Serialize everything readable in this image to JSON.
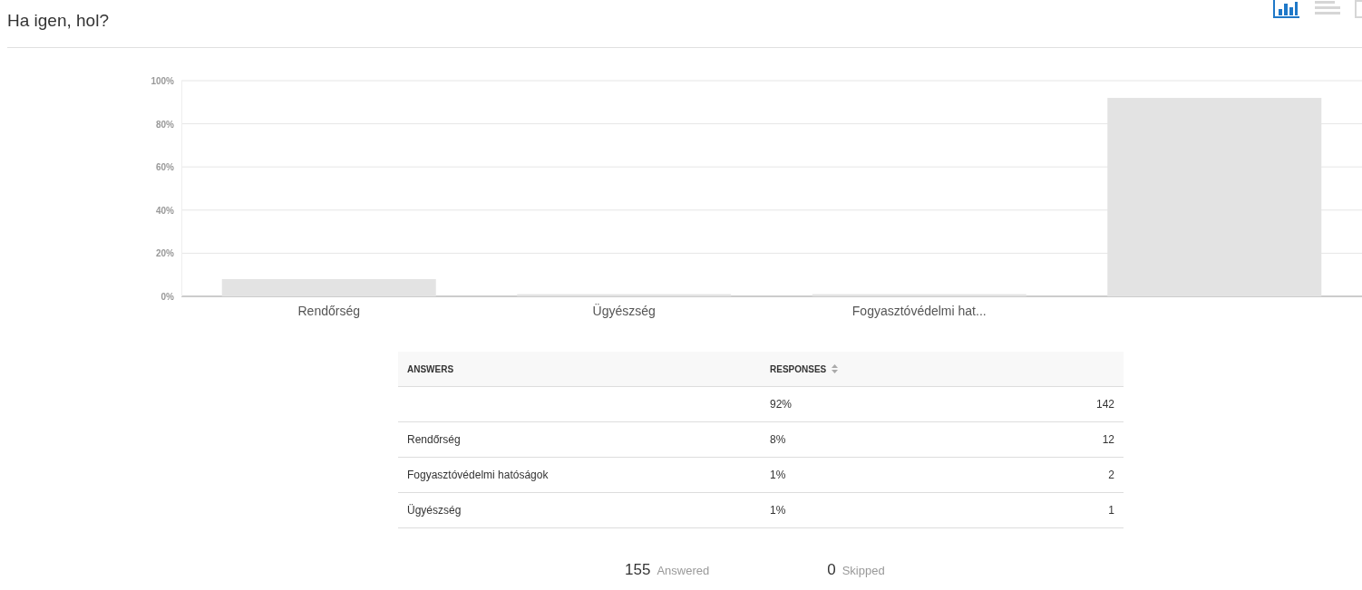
{
  "question": {
    "title": "Ha igen, hol?"
  },
  "view_toggles": [
    {
      "kind": "bar",
      "selected": true
    },
    {
      "kind": "list",
      "selected": false
    },
    {
      "kind": "table",
      "selected": false
    }
  ],
  "chart_data": {
    "type": "bar",
    "categories": [
      "Rendőrség",
      "Ügyészség",
      "Fogyasztóvédelmi hat...",
      null
    ],
    "values": [
      8,
      1,
      1,
      92
    ],
    "grid": true,
    "ylim": [
      0,
      100
    ],
    "yticks": [
      {
        "value": 0,
        "label": "0%"
      },
      {
        "value": 20,
        "label": "20%"
      },
      {
        "value": 40,
        "label": "40%"
      },
      {
        "value": 60,
        "label": "60%"
      },
      {
        "value": 80,
        "label": "80%"
      },
      {
        "value": 100,
        "label": "100%"
      }
    ]
  },
  "table": {
    "columns": [
      "ANSWERS",
      "RESPONSES"
    ],
    "rows": [
      {
        "answer": null,
        "percent": "92%",
        "count": "142"
      },
      {
        "answer": "Rendőrség",
        "percent": "8%",
        "count": "12"
      },
      {
        "answer": "Fogyasztóvédelmi hatóságok",
        "percent": "1%",
        "count": "2"
      },
      {
        "answer": "Ügyészség",
        "percent": "1%",
        "count": "1"
      }
    ]
  },
  "summary": {
    "answered": {
      "count": "155",
      "label": "Answered"
    },
    "skipped": {
      "count": "0",
      "label": "Skipped"
    }
  }
}
